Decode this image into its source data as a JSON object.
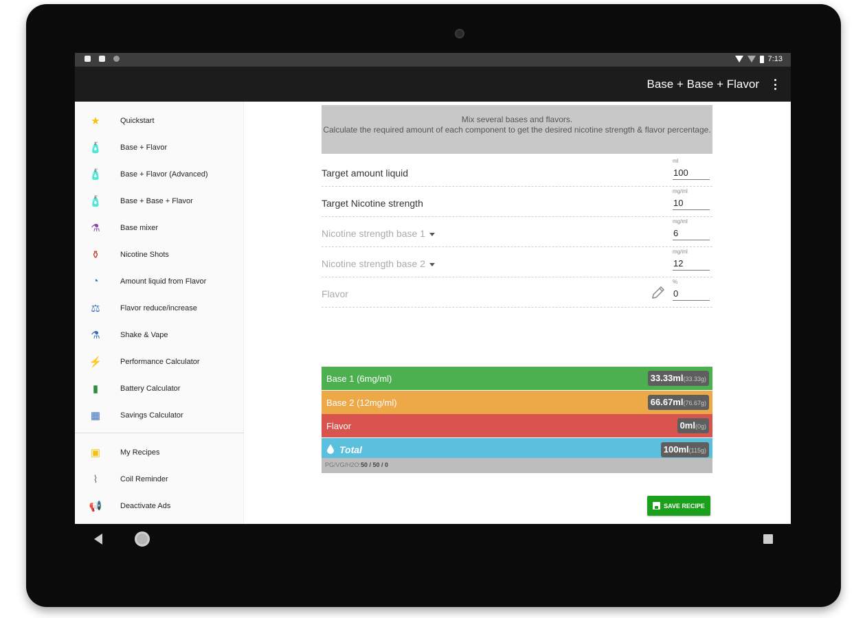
{
  "statusbar": {
    "time": "7:13"
  },
  "appbar": {
    "title": "Base + Base + Flavor"
  },
  "drawer": {
    "items": [
      {
        "label": "Quickstart",
        "icon": "star-icon",
        "glyph": "★",
        "color": "#f4c20d"
      },
      {
        "label": "Base + Flavor",
        "icon": "bottle-icon",
        "glyph": "🧴",
        "color": "#e67e22"
      },
      {
        "label": "Base + Flavor (Advanced)",
        "icon": "bottle-advanced-icon",
        "glyph": "🧴",
        "color": "#3b6fb6"
      },
      {
        "label": "Base + Base + Flavor",
        "icon": "bottles-icon",
        "glyph": "🧴",
        "color": "#e67e22"
      },
      {
        "label": "Base mixer",
        "icon": "mixer-icon",
        "glyph": "⚗",
        "color": "#8e44ad"
      },
      {
        "label": "Nicotine Shots",
        "icon": "shot-icon",
        "glyph": "⚱",
        "color": "#c0392b"
      },
      {
        "label": "Amount liquid from Flavor",
        "icon": "pie-chart-icon",
        "glyph": "◔",
        "color": "#3b6fb6"
      },
      {
        "label": "Flavor reduce/increase",
        "icon": "scale-icon",
        "glyph": "⚖",
        "color": "#3b6fb6"
      },
      {
        "label": "Shake & Vape",
        "icon": "shake-icon",
        "glyph": "⚗",
        "color": "#3b6fb6"
      },
      {
        "label": "Performance Calculator",
        "icon": "lightning-icon",
        "glyph": "⚡",
        "color": "#f39c12"
      },
      {
        "label": "Battery Calculator",
        "icon": "battery-icon",
        "glyph": "▮",
        "color": "#2e8b3d"
      },
      {
        "label": "Savings Calculator",
        "icon": "bar-chart-icon",
        "glyph": "▦",
        "color": "#3b6fb6"
      }
    ],
    "secondary_items": [
      {
        "label": "My Recipes",
        "icon": "recipe-book-icon",
        "glyph": "▣",
        "color": "#f4c20d"
      },
      {
        "label": "Coil Reminder",
        "icon": "coil-icon",
        "glyph": "⌇",
        "color": "#777777"
      },
      {
        "label": "Deactivate Ads",
        "icon": "megaphone-icon",
        "glyph": "📢",
        "color": "#777777"
      }
    ]
  },
  "info": {
    "line1": "Mix several bases and flavors.",
    "line2": "Calculate the required amount of each component to get the desired nicotine strength & flavor percentage."
  },
  "form": {
    "target_amount": {
      "label": "Target amount liquid",
      "unit": "ml",
      "value": "100"
    },
    "target_nicotine": {
      "label": "Target Nicotine strength",
      "unit": "mg/ml",
      "value": "10"
    },
    "nicotine_base1": {
      "label": "Nicotine strength base 1",
      "unit": "mg/ml",
      "value": "6"
    },
    "nicotine_base2": {
      "label": "Nicotine strength base 2",
      "unit": "mg/ml",
      "value": "12"
    },
    "flavor": {
      "label": "Flavor",
      "unit": "%",
      "value": "0"
    }
  },
  "results": {
    "base1": {
      "label": "Base 1 (6mg/ml)",
      "value": "33.33ml",
      "sub": "(33.33g)"
    },
    "base2": {
      "label": "Base 2 (12mg/ml)",
      "value": "66.67ml",
      "sub": "(76.67g)"
    },
    "flavor": {
      "label": "Flavor",
      "value": "0ml",
      "sub": "(0g)"
    },
    "total": {
      "label": "Total",
      "value": "100ml",
      "sub": "(115g)"
    },
    "pgvg_label": "PG/VG/H2O:",
    "pgvg_value": "50 / 50 / 0"
  },
  "save_button": {
    "label": "SAVE RECIPE"
  }
}
